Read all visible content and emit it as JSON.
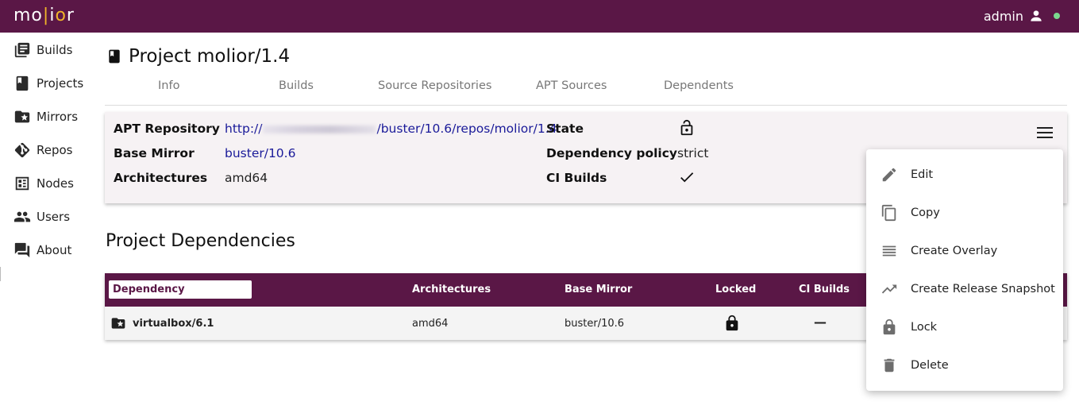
{
  "header": {
    "logo_left": "mo",
    "logo_bar": "|",
    "logo_i": "i",
    "logo_o": "o",
    "logo_r": "r",
    "username": "admin",
    "brand_color": "#5a1746",
    "status_color": "#7bd88f"
  },
  "sidebar": {
    "items": [
      {
        "label": "Builds",
        "icon": "builds-icon"
      },
      {
        "label": "Projects",
        "icon": "book-icon"
      },
      {
        "label": "Mirrors",
        "icon": "star-folder-icon"
      },
      {
        "label": "Repos",
        "icon": "git-icon"
      },
      {
        "label": "Nodes",
        "icon": "nodes-icon"
      },
      {
        "label": "Users",
        "icon": "users-icon"
      },
      {
        "label": "About",
        "icon": "forum-icon"
      }
    ]
  },
  "page": {
    "title": "Project molior/1.4"
  },
  "tabs": [
    "Info",
    "Builds",
    "Source Repositories",
    "APT Sources",
    "Dependents"
  ],
  "info": {
    "apt_repository_label": "APT Repository",
    "apt_repository_prefix": "http://",
    "apt_repository_suffix": "/buster/10.6/repos/molior/1.4",
    "base_mirror_label": "Base Mirror",
    "base_mirror_value": "buster/10.6",
    "architectures_label": "Architectures",
    "architectures_value": "amd64",
    "state_label": "State",
    "state_icon": "lock-open-icon",
    "dependency_policy_label": "Dependency policy",
    "dependency_policy_value": "strict",
    "ci_builds_label": "CI Builds",
    "ci_builds_icon": "check-icon"
  },
  "dependencies": {
    "title": "Project Dependencies",
    "columns": {
      "dependency": "Dependency",
      "architectures": "Architectures",
      "base_mirror": "Base Mirror",
      "locked": "Locked",
      "ci_builds": "CI Builds"
    },
    "rows": [
      {
        "name": "virtualbox/6.1",
        "architectures": "amd64",
        "base_mirror": "buster/10.6",
        "locked_icon": "lock-icon",
        "ci_builds": "—"
      }
    ]
  },
  "menu": {
    "items": [
      {
        "label": "Edit",
        "icon": "pencil-icon"
      },
      {
        "label": "Copy",
        "icon": "copy-icon"
      },
      {
        "label": "Create Overlay",
        "icon": "overlay-icon"
      },
      {
        "label": "Create Release Snapshot",
        "icon": "trending-up-icon"
      },
      {
        "label": "Lock",
        "icon": "lock-icon"
      },
      {
        "label": "Delete",
        "icon": "trash-icon"
      }
    ]
  }
}
